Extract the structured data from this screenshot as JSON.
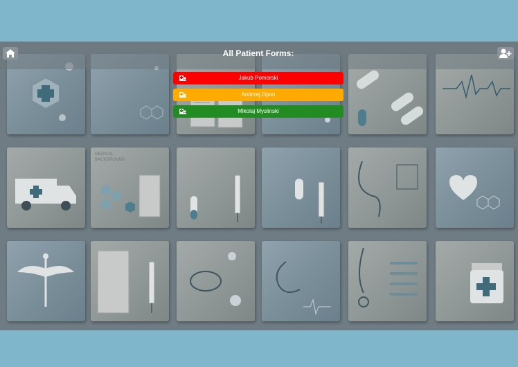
{
  "header": {
    "title": "All Patient Forms:",
    "home_icon": "home-icon",
    "add_user_icon": "user-plus-icon"
  },
  "forms": [
    {
      "name": "Jakub Pomorski",
      "color": "#ff0000",
      "icon": "hospital-user-icon"
    },
    {
      "name": "Andrzej Opon",
      "color": "#ffaa00",
      "icon": "hospital-user-icon"
    },
    {
      "name": "Mikolaj Myslinski",
      "color": "#228b22",
      "icon": "hospital-user-icon"
    }
  ],
  "background": {
    "tile_text": "MEDICAL BACKGROUND"
  }
}
